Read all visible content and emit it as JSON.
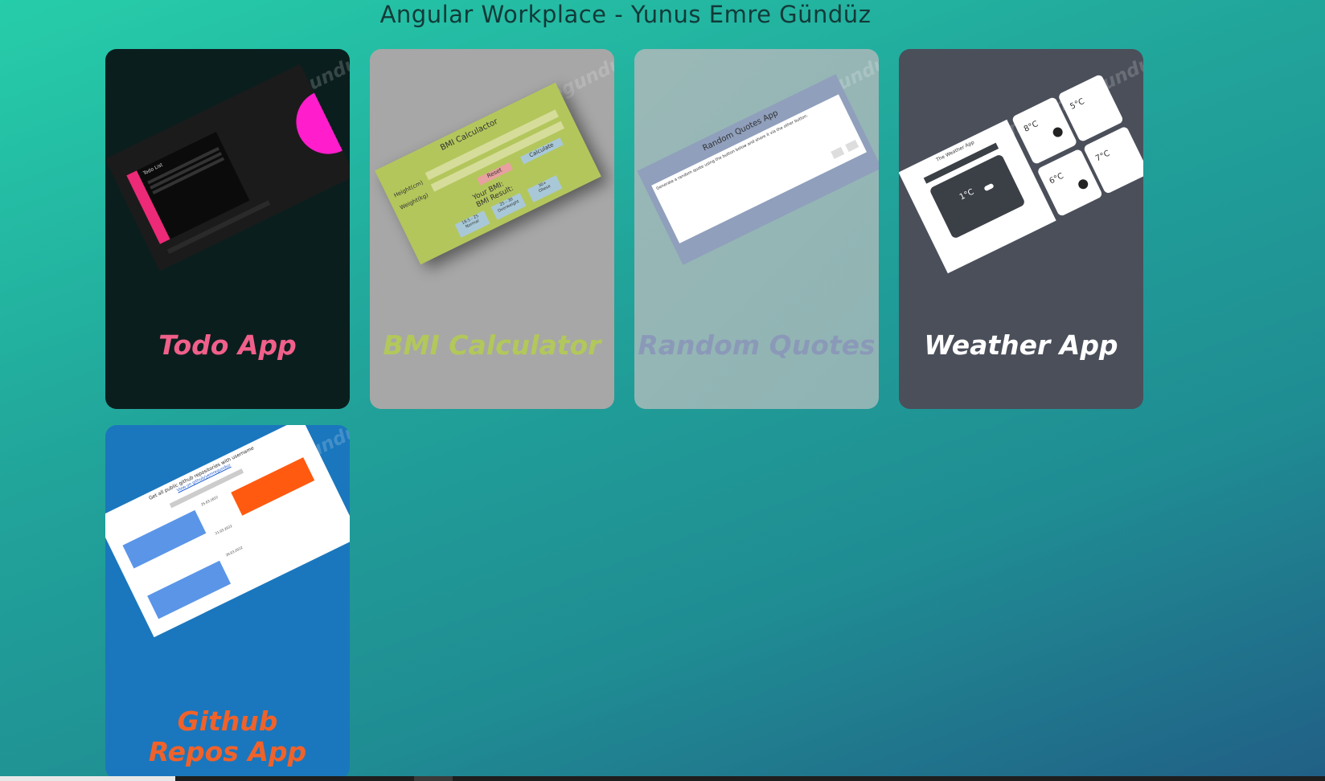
{
  "page": {
    "title": "Angular Workplace - Yunus Emre Gündüz"
  },
  "watermark": "github.com/yemregunduz",
  "cards": [
    {
      "label": "Todo App",
      "bg": "#0b1e1e",
      "label_color": "#f0608a"
    },
    {
      "label": "BMI Calculator",
      "bg": "#a7a7a7",
      "label_color": "#b2c85a"
    },
    {
      "label": "Random Quotes",
      "bg": "#93b7b5",
      "label_color": "#8b99b8"
    },
    {
      "label": "Weather App",
      "bg": "#4a4f5a",
      "label_color": "#ffffff"
    },
    {
      "label": "Github Repos App",
      "bg": "#1a77bd",
      "label_color": "#f0622a"
    }
  ],
  "thumbs": {
    "todo": {
      "title": "Todo List"
    },
    "bmi": {
      "title": "BMI Calculactor",
      "height_label": "Height(cm)",
      "weight_label": "Weight(kg)",
      "reset": "Reset",
      "calculate": "Calculate",
      "result_line1": "Your BMI:",
      "result_line2": "BMI Result:",
      "normal": "18.5 - 25\nNormal",
      "over": "25 - 30\nOverweight",
      "obese": "30+\nObese"
    },
    "quotes": {
      "title": "Random Quotes App",
      "text": "Generate a random quote using the button below and share it via the other button."
    },
    "weather": {
      "title": "The Weather App",
      "main_temp": "1°C",
      "t1": "8°C",
      "t2": "5°C",
      "t3": "6°C",
      "t4": "7°C"
    },
    "github": {
      "title": "Get all public github repositories with username",
      "link": "View on github/yemregunduz",
      "date1": "25.03.2022",
      "date2": "21.03.2022",
      "date3": "20.03.2022"
    }
  }
}
